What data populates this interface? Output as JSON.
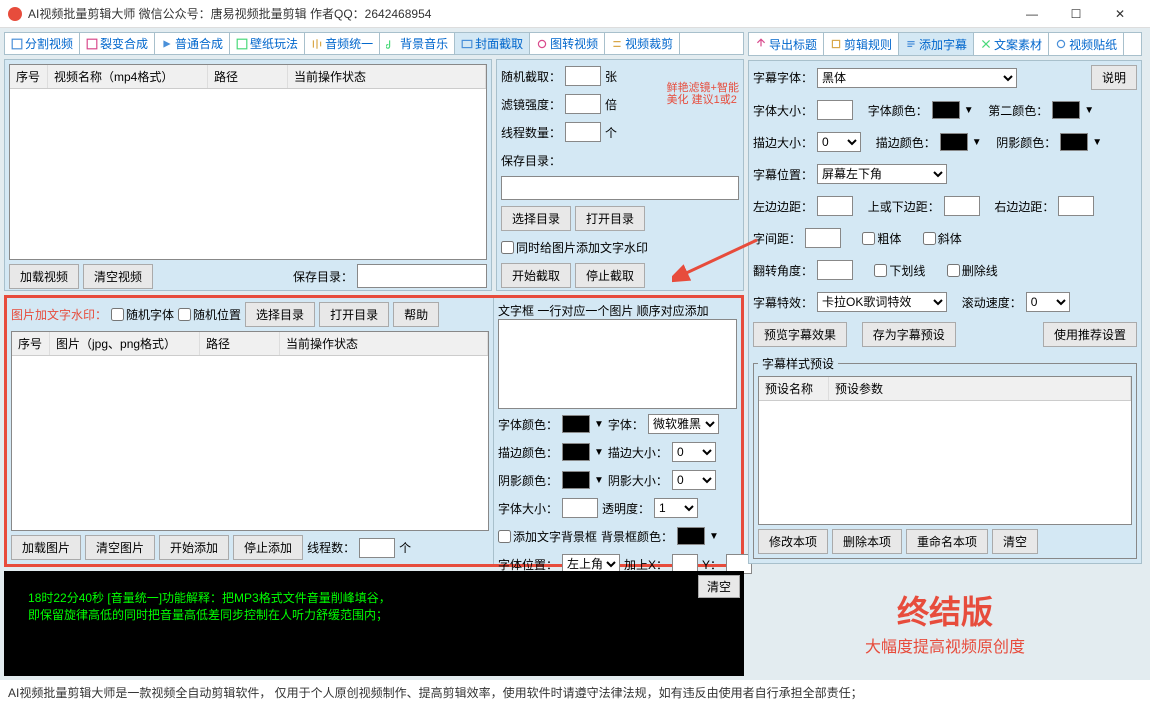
{
  "title": "AI视频批量剪辑大师    微信公众号：唐易视频批量剪辑    作者QQ：2642468954",
  "tabs_left": [
    "分割视频",
    "裂变合成",
    "普通合成",
    "壁纸玩法",
    "音频统一",
    "背景音乐",
    "封面截取",
    "图转视频",
    "视频裁剪"
  ],
  "tabs_right": [
    "导出标题",
    "剪辑规则",
    "添加字幕",
    "文案素材",
    "视频贴纸"
  ],
  "top_grid": {
    "cols": [
      "序号",
      "视频名称（mp4格式）",
      "路径",
      "当前操作状态"
    ]
  },
  "top_btns": {
    "load": "加载视频",
    "clear": "清空视频",
    "savedir": "保存目录："
  },
  "watermark": {
    "label": "图片加文字水印：",
    "rand_font": "随机字体",
    "rand_pos": "随机位置",
    "choose_dir": "选择目录",
    "open_dir": "打开目录",
    "help": "帮助",
    "grid_cols": [
      "序号",
      "图片（jpg、png格式）",
      "路径",
      "当前操作状态"
    ],
    "load": "加载图片",
    "clear": "清空图片",
    "start": "开始添加",
    "stop": "停止添加",
    "threads": "线程数：",
    "threads_unit": "个"
  },
  "capture": {
    "rand_cap": "随机截取：",
    "rand_cap_unit": "张",
    "filter": "滤镜强度：",
    "filter_unit": "倍",
    "hint": "鲜艳滤镜+智能\n美化 建议1或2",
    "threads": "线程数量：",
    "threads_unit": "个",
    "savedir": "保存目录：",
    "choose_dir": "选择目录",
    "open_dir": "打开目录",
    "add_wm": "同时给图片添加文字水印",
    "start": "开始截取",
    "stop": "停止截取"
  },
  "textbox": {
    "label": "文字框 一行对应一个图片 顺序对应添加",
    "font_color": "字体颜色：",
    "font": "字体：",
    "font_val": "微软雅黑",
    "stroke_color": "描边颜色：",
    "stroke_size": "描边大小：",
    "stroke_size_val": "0",
    "shadow_color": "阴影颜色：",
    "shadow_size": "阴影大小：",
    "shadow_size_val": "0",
    "font_size": "字体大小：",
    "opacity": "透明度：",
    "opacity_val": "1",
    "bg_box": "添加文字背景框",
    "bg_color": "背景框颜色：",
    "pos": "字体位置：",
    "pos_val": "左上角",
    "add_x": "加上X：",
    "y": "Y："
  },
  "subtitle": {
    "explain": "说明",
    "font": "字幕字体：",
    "font_val": "黑体",
    "size": "字体大小：",
    "color": "字体颜色：",
    "color2": "第二颜色：",
    "stroke": "描边大小：",
    "stroke_val": "0",
    "stroke_color": "描边颜色：",
    "shadow_color": "阴影颜色：",
    "pos": "字幕位置：",
    "pos_val": "屏幕左下角",
    "left": "左边边距：",
    "topbot": "上或下边距：",
    "right": "右边边距：",
    "spacing": "字间距：",
    "bold": "粗体",
    "italic": "斜体",
    "rotate": "翻转角度：",
    "underline": "下划线",
    "strike": "删除线",
    "effect": "字幕特效：",
    "effect_val": "卡拉OK歌词特效",
    "speed": "滚动速度：",
    "speed_val": "0",
    "preview": "预览字幕效果",
    "save_preset": "存为字幕预设",
    "recommend": "使用推荐设置",
    "preset_legend": "字幕样式预设",
    "preset_cols": [
      "预设名称",
      "预设参数"
    ],
    "modify": "修改本项",
    "delete": "删除本项",
    "rename": "重命名本项",
    "clear": "清空"
  },
  "console": {
    "text": "18时22分40秒 [音量统一]功能解释：把MP3格式文件音量削峰填谷，\n      即保留旋律高低的同时把音量高低差同步控制在人听力舒缓范围内；",
    "clear": "清空"
  },
  "brand": {
    "big": "终结版",
    "sub": "大幅度提高视频原创度"
  },
  "footer": "AI视频批量剪辑大师是一款视频全自动剪辑软件，  仅用于个人原创视频制作、提高剪辑效率，使用软件时请遵守法律法规，如有违反由使用者自行承担全部责任；"
}
